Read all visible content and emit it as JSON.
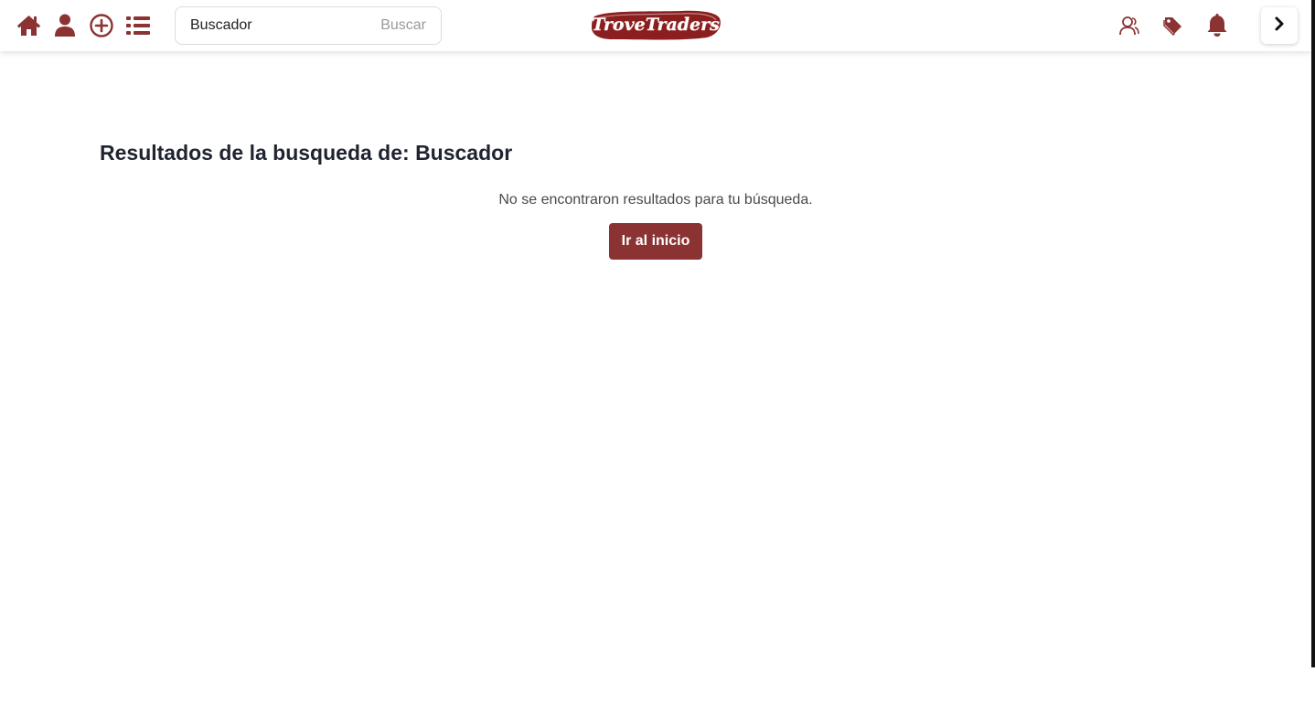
{
  "colors": {
    "brand": "#8b3232",
    "brand_dark": "#6e1f1f",
    "text": "#1f2430",
    "muted_text": "#4a4a4a"
  },
  "navbar": {
    "left_icons": [
      "home-icon",
      "user-icon",
      "plus-circle-icon",
      "list-icon"
    ],
    "search": {
      "value": "Buscador",
      "button_label": "Buscar"
    },
    "logo_text": "TroveTraders",
    "right_icons": [
      "users-icon",
      "tags-icon",
      "bell-icon",
      "chevron-right-icon"
    ]
  },
  "main": {
    "title": "Resultados de la busqueda de: Buscador",
    "empty_message": "No se encontraron resultados para tu búsqueda.",
    "home_button_label": "Ir al inicio"
  }
}
